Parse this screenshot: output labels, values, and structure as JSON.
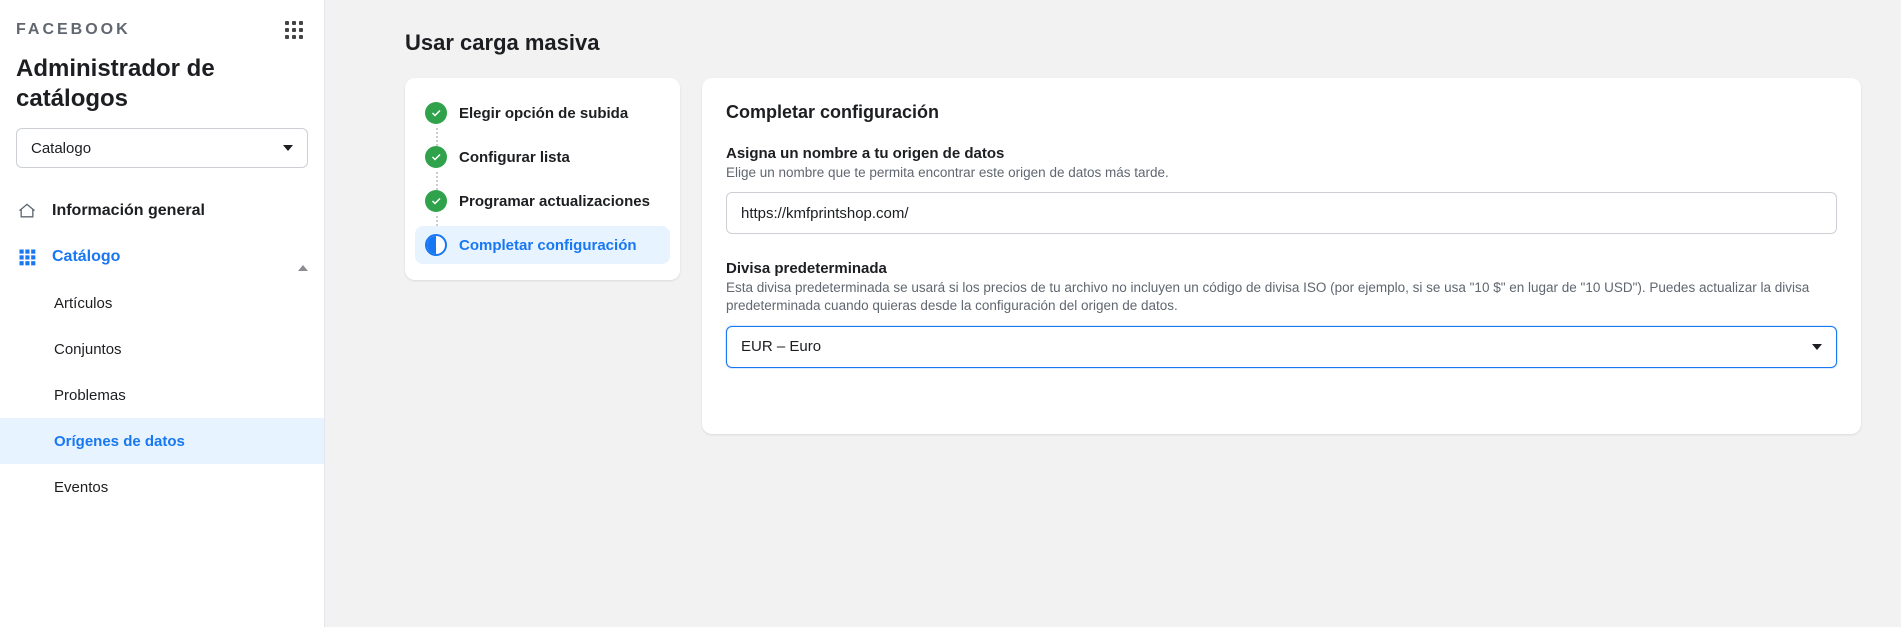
{
  "brand": "FACEBOOK",
  "app_title": "Administrador de catálogos",
  "catalog_selector": {
    "value": "Catalogo"
  },
  "nav": {
    "overview": "Información general",
    "catalog": "Catálogo",
    "sub": {
      "items": "Artículos",
      "sets": "Conjuntos",
      "problems": "Problemas",
      "data_sources": "Orígenes de datos",
      "events": "Eventos"
    }
  },
  "page": {
    "heading": "Usar carga masiva"
  },
  "steps": [
    {
      "label": "Elegir opción de subida",
      "state": "done"
    },
    {
      "label": "Configurar lista",
      "state": "done"
    },
    {
      "label": "Programar actualizaciones",
      "state": "done"
    },
    {
      "label": "Completar configuración",
      "state": "current"
    }
  ],
  "form": {
    "title": "Completar configuración",
    "name_field": {
      "label": "Asigna un nombre a tu origen de datos",
      "help": "Elige un nombre que te permita encontrar este origen de datos más tarde.",
      "value": "https://kmfprintshop.com/"
    },
    "currency_field": {
      "label": "Divisa predeterminada",
      "help": "Esta divisa predeterminada se usará si los precios de tu archivo no incluyen un código de divisa ISO (por ejemplo, si se usa \"10 $\" en lugar de \"10 USD\"). Puedes actualizar la divisa predeterminada cuando quieras desde la configuración del origen de datos.",
      "value": "EUR – Euro"
    }
  }
}
